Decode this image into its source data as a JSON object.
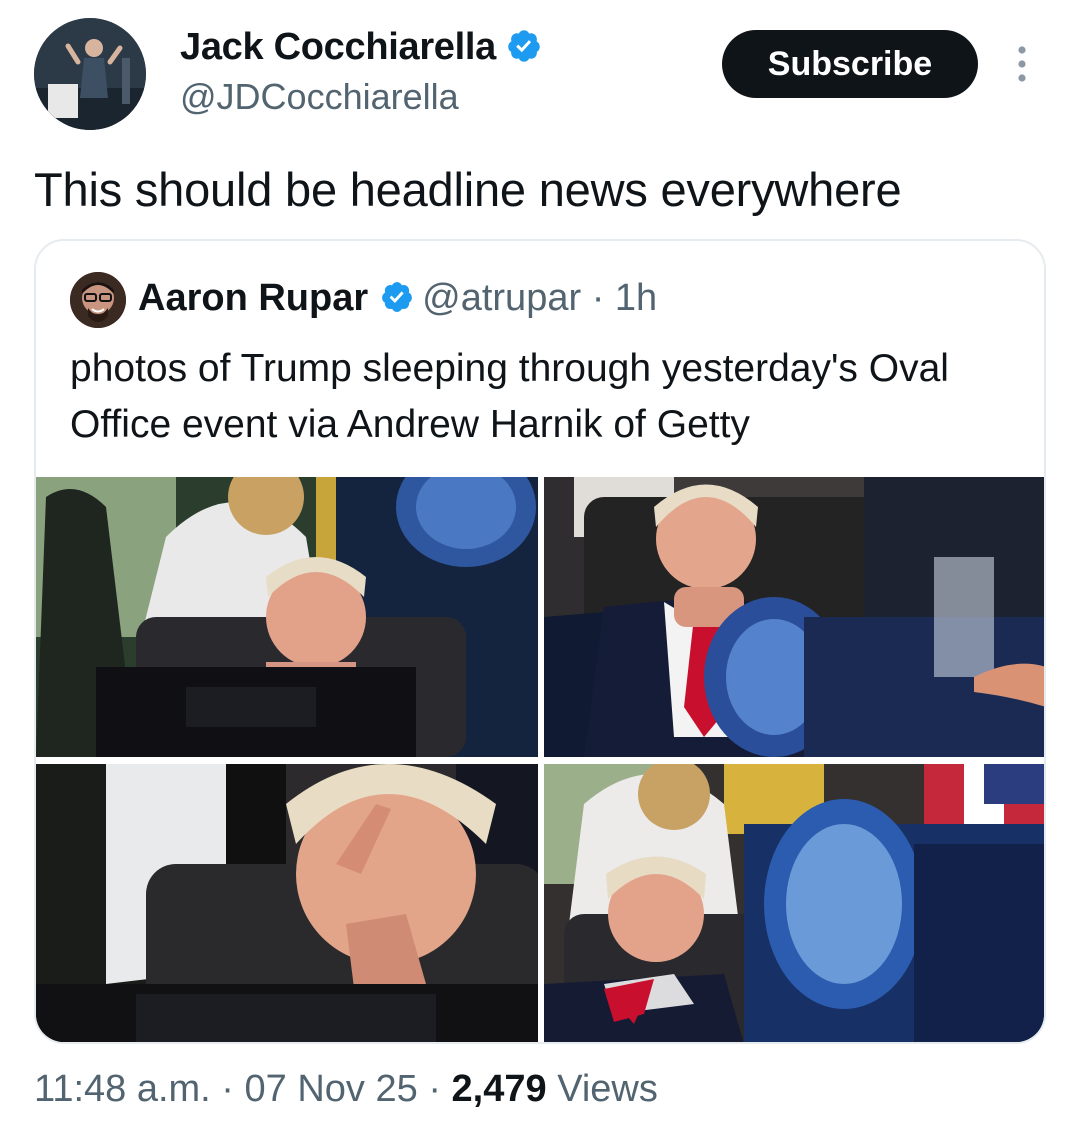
{
  "author": {
    "name": "Jack Cocchiarella",
    "handle": "@JDCocchiarella",
    "verified": true
  },
  "subscribe_label": "Subscribe",
  "tweet_text": "This should be headline news everywhere",
  "quoted_tweet": {
    "name": "Aaron Rupar",
    "handle": "@atrupar",
    "separator": "·",
    "time": "1h",
    "text": "photos of Trump sleeping through yesterday's Oval Office event via Andrew Harnik of Getty",
    "photo_count": 4
  },
  "meta": {
    "time": "11:48 a.m.",
    "sep1": "·",
    "date": "07 Nov 25",
    "sep2": "·",
    "views_count": "2,479",
    "views_label": "Views"
  },
  "colors": {
    "verified_blue": "#1d9bf0",
    "text_primary": "#0f1419",
    "text_secondary": "#536471",
    "border": "#e6ebef",
    "tie_red": "#c8102e"
  },
  "icons": [
    "verified-badge-icon",
    "more-options-icon"
  ]
}
